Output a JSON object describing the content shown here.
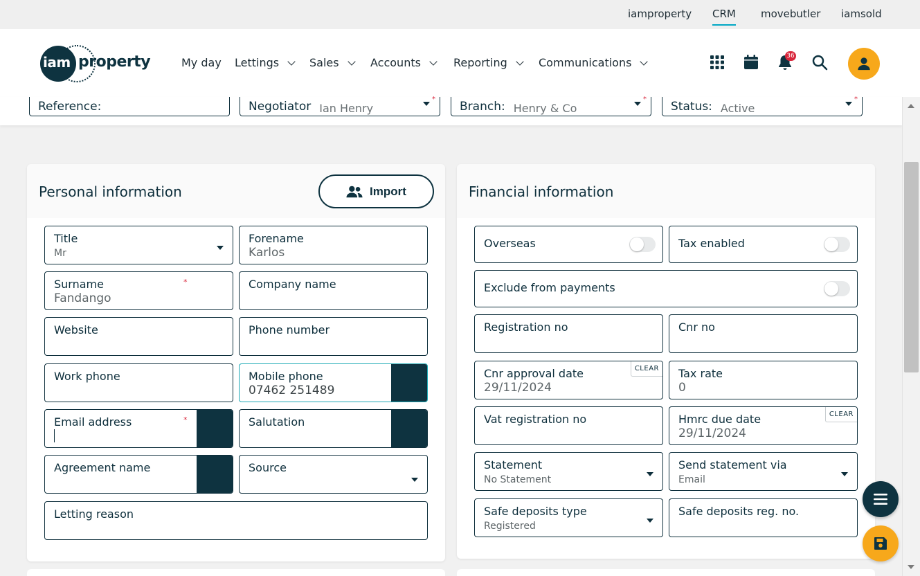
{
  "topbar": {
    "links": [
      {
        "label": "iamproperty",
        "active": false
      },
      {
        "label": "CRM",
        "active": true
      },
      {
        "label": "movebutler",
        "active": false
      },
      {
        "label": "iamsold",
        "active": false
      }
    ]
  },
  "brand": {
    "logo_text_circle": "iam",
    "logo_text_word": "property",
    "accent_color": "#f7a81b",
    "primary_color": "#0e3340"
  },
  "nav": {
    "menu": [
      {
        "label": "My day",
        "dropdown": false
      },
      {
        "label": "Lettings",
        "dropdown": true
      },
      {
        "label": "Sales",
        "dropdown": true
      },
      {
        "label": "Accounts",
        "dropdown": true
      },
      {
        "label": "Reporting",
        "dropdown": true
      },
      {
        "label": "Communications",
        "dropdown": true
      }
    ],
    "icons": [
      "apps-grid-icon",
      "calendar-icon",
      "bell-icon",
      "search-icon",
      "user-icon"
    ],
    "notification_count": "36"
  },
  "filters": {
    "reference": {
      "label": "Reference:",
      "value": ""
    },
    "negotiator": {
      "label": "Negotiator",
      "value": "Ian Henry"
    },
    "branch": {
      "label": "Branch:",
      "value": "Henry & Co"
    },
    "status": {
      "label": "Status:",
      "value": "Active"
    },
    "required_mark": "*"
  },
  "personal": {
    "title": "Personal information",
    "import_label": "Import",
    "fields": {
      "title": {
        "label": "Title",
        "value": "Mr"
      },
      "forename": {
        "label": "Forename",
        "value": "Karlos"
      },
      "surname": {
        "label": "Surname",
        "value": "Fandango"
      },
      "company": {
        "label": "Company name",
        "value": ""
      },
      "website": {
        "label": "Website",
        "value": ""
      },
      "phone": {
        "label": "Phone number",
        "value": ""
      },
      "work_phone": {
        "label": "Work phone",
        "value": ""
      },
      "mobile": {
        "label": "Mobile phone",
        "value": "07462 251489"
      },
      "email": {
        "label": "Email address",
        "value": ""
      },
      "salutation": {
        "label": "Salutation",
        "value": ""
      },
      "agreement": {
        "label": "Agreement name",
        "value": ""
      },
      "source": {
        "label": "Source",
        "value": ""
      },
      "letting_reason": {
        "label": "Letting reason",
        "value": ""
      }
    }
  },
  "financial": {
    "title": "Financial information",
    "clear_label": "CLEAR",
    "fields": {
      "overseas": {
        "label": "Overseas",
        "on": false
      },
      "tax_enabled": {
        "label": "Tax enabled",
        "on": false
      },
      "exclude": {
        "label": "Exclude from payments",
        "on": false
      },
      "registration_no": {
        "label": "Registration no",
        "value": ""
      },
      "cnr_no": {
        "label": "Cnr no",
        "value": ""
      },
      "cnr_approval": {
        "label": "Cnr approval date",
        "value": "29/11/2024"
      },
      "tax_rate": {
        "label": "Tax rate",
        "value": "0"
      },
      "vat_reg": {
        "label": "Vat registration no",
        "value": ""
      },
      "hmrc_due": {
        "label": "Hmrc due date",
        "value": "29/11/2024"
      },
      "statement": {
        "label": "Statement",
        "value": "No Statement"
      },
      "send_via": {
        "label": "Send statement via",
        "value": "Email"
      },
      "safe_type": {
        "label": "Safe deposits type",
        "value": "Registered"
      },
      "safe_reg": {
        "label": "Safe deposits reg. no.",
        "value": ""
      }
    }
  }
}
